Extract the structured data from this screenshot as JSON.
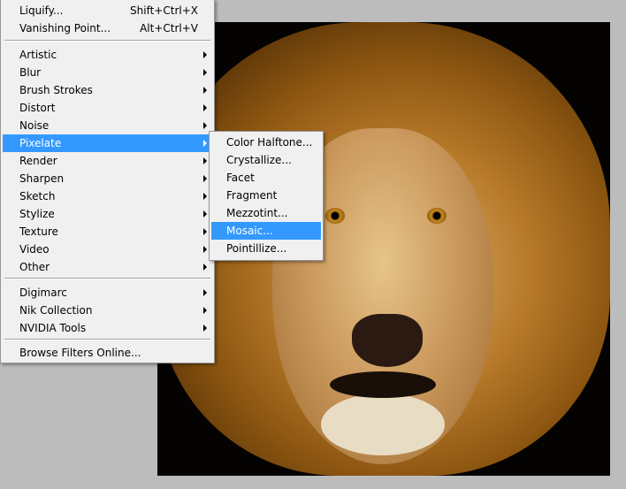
{
  "canvas": {
    "image": "lion-photo"
  },
  "menu": {
    "top": [
      {
        "label": "Liquify...",
        "shortcut": "Shift+Ctrl+X"
      },
      {
        "label": "Vanishing Point...",
        "shortcut": "Alt+Ctrl+V"
      }
    ],
    "groups": [
      {
        "label": "Artistic"
      },
      {
        "label": "Blur"
      },
      {
        "label": "Brush Strokes"
      },
      {
        "label": "Distort"
      },
      {
        "label": "Noise"
      },
      {
        "label": "Pixelate",
        "highlighted": true
      },
      {
        "label": "Render"
      },
      {
        "label": "Sharpen"
      },
      {
        "label": "Sketch"
      },
      {
        "label": "Stylize"
      },
      {
        "label": "Texture"
      },
      {
        "label": "Video"
      },
      {
        "label": "Other"
      }
    ],
    "plugins": [
      {
        "label": "Digimarc"
      },
      {
        "label": "Nik Collection"
      },
      {
        "label": "NVIDIA Tools"
      }
    ],
    "browse": "Browse Filters Online..."
  },
  "submenu": {
    "items": [
      {
        "label": "Color Halftone..."
      },
      {
        "label": "Crystallize..."
      },
      {
        "label": "Facet"
      },
      {
        "label": "Fragment"
      },
      {
        "label": "Mezzotint..."
      },
      {
        "label": "Mosaic...",
        "highlighted": true
      },
      {
        "label": "Pointillize..."
      }
    ]
  },
  "colors": {
    "highlight": "#3399ff",
    "menu_bg": "#f0f0f0"
  }
}
